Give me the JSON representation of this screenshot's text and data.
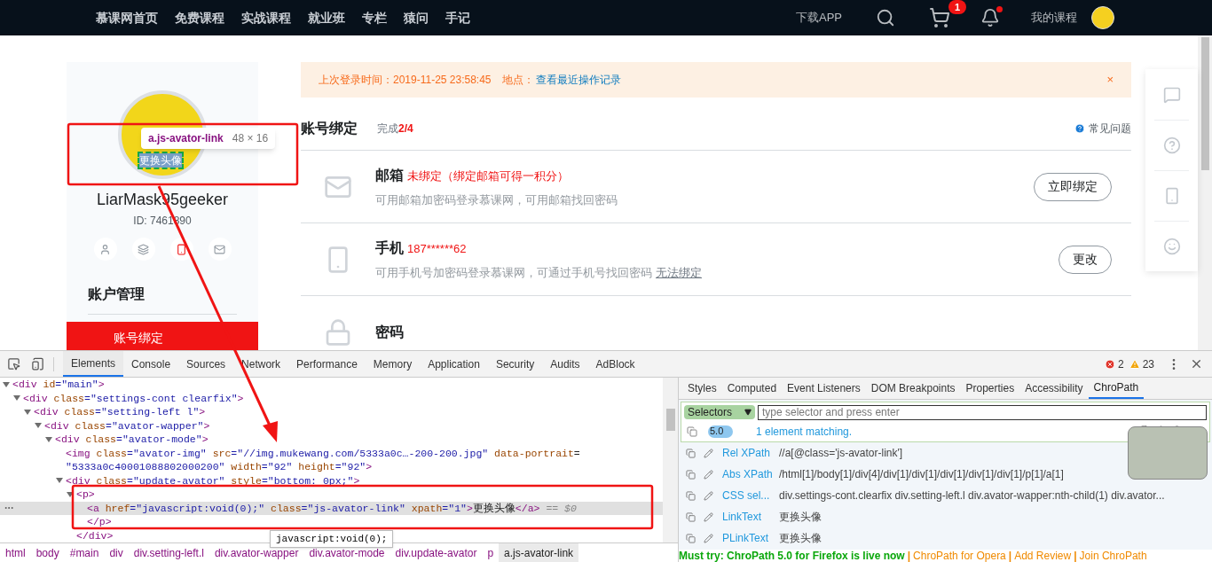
{
  "nav": {
    "items": [
      "慕课网首页",
      "免费课程",
      "实战课程",
      "就业班",
      "专栏",
      "猿问",
      "手记"
    ],
    "download": "下载APP",
    "cart_badge": "1",
    "my_courses": "我的课程"
  },
  "sidebar": {
    "tooltip": {
      "selector": "a.js-avator-link",
      "size": "48 × 16"
    },
    "avatar_link": "更换头像",
    "username": "LiarMask95geeker",
    "user_id": "ID: 7461890",
    "profile_icons": [
      {
        "kind": "user",
        "selected": false
      },
      {
        "kind": "layers",
        "selected": false
      },
      {
        "kind": "phone",
        "selected": true
      },
      {
        "kind": "mail",
        "selected": false
      }
    ],
    "section_title": "账户管理",
    "menu": [
      {
        "label": "账号绑定",
        "selected": true
      }
    ]
  },
  "notice": {
    "text": "上次登录时间：2019-11-25 23:58:45",
    "location_label": "地点：",
    "link": "查看最近操作记录",
    "close": "×"
  },
  "binding": {
    "title": "账号绑定",
    "progress_label": "完成",
    "progress": "2/4",
    "help": "常见问题",
    "rows": [
      {
        "kind": "mail",
        "name": "邮箱",
        "status": "未绑定（绑定邮箱可得一积分）",
        "description": "可用邮箱加密码登录慕课网，可用邮箱找回密码",
        "button": "立即绑定"
      },
      {
        "kind": "phone",
        "name": "手机",
        "status": "187******62",
        "description": "可用手机号加密码登录慕课网，可通过手机号找回密码",
        "link": "无法绑定",
        "button": "更改"
      },
      {
        "kind": "lock",
        "name": "密码"
      }
    ]
  },
  "float_toolbar": [
    {
      "kind": "feedback"
    },
    {
      "kind": "help"
    },
    {
      "kind": "phone"
    },
    {
      "kind": "chat"
    }
  ],
  "devtools": {
    "tabs": [
      {
        "label": "Elements",
        "selected": true
      },
      {
        "label": "Console",
        "selected": false
      },
      {
        "label": "Sources",
        "selected": false
      },
      {
        "label": "Network",
        "selected": false
      },
      {
        "label": "Performance",
        "selected": false
      },
      {
        "label": "Memory",
        "selected": false
      },
      {
        "label": "Application",
        "selected": false
      },
      {
        "label": "Security",
        "selected": false
      },
      {
        "label": "Audits",
        "selected": false
      },
      {
        "label": "AdBlock",
        "selected": false
      }
    ],
    "errors": "2",
    "warnings": "23",
    "tree": [
      {
        "lines": [
          "<div id=\"main\">"
        ],
        "expanded": true,
        "selected": false,
        "children": [
          {
            "lines": [
              "<div class=\"settings-cont clearfix\">"
            ],
            "expanded": true,
            "selected": false,
            "children": [
              {
                "lines": [
                  "<div class=\"setting-left l\">"
                ],
                "expanded": true,
                "selected": false,
                "children": [
                  {
                    "lines": [
                      "<div class=\"avator-wapper\">"
                    ],
                    "expanded": true,
                    "selected": false,
                    "children": [
                      {
                        "lines": [
                          "<div class=\"avator-mode\">"
                        ],
                        "expanded": true,
                        "selected": false,
                        "children": [
                          {
                            "lines": [
                              "<img class=\"avator-img\" src=\"//img.mukewang.com/5333a0c…-200-200.jpg\" data-portrait=",
                              "\"5333a0c40001088802000200\" width=\"92\" height=\"92\">"
                            ],
                            "selected": false
                          },
                          {
                            "lines": [
                              "<div class=\"update-avator\" style=\"bottom: 0px;\">"
                            ],
                            "expanded": true,
                            "selected": false,
                            "children": [
                              {
                                "lines": [
                                  "<p>"
                                ],
                                "expanded": true,
                                "selected": false,
                                "children": [
                                  {
                                    "lines": [
                                      "<a href=\"javascript:void(0);\" class=\"js-avator-link\" xpath=\"1\">更换头像</a>"
                                    ],
                                    "suffix": "== $0",
                                    "selected": true
                                  },
                                  {
                                    "lines": [
                                      "</p>"
                                    ],
                                    "selected": false
                                  }
                                ]
                              },
                              {
                                "lines": [
                                  "</div>"
                                ],
                                "selected": false
                              }
                            ]
                          }
                        ]
                      }
                    ]
                  }
                ]
              }
            ]
          }
        ]
      }
    ],
    "link_tooltip": "javascript:void(0);",
    "breadcrumbs": [
      {
        "label": "html",
        "selected": false
      },
      {
        "label": "body",
        "selected": false
      },
      {
        "label": "#main",
        "selected": false
      },
      {
        "label": "div",
        "selected": false
      },
      {
        "label": "div.setting-left.l",
        "selected": false
      },
      {
        "label": "div.avator-wapper",
        "selected": false
      },
      {
        "label": "div.avator-mode",
        "selected": false
      },
      {
        "label": "div.update-avator",
        "selected": false
      },
      {
        "label": "p",
        "selected": false
      },
      {
        "label": "a.js-avator-link",
        "selected": true
      }
    ],
    "side_tabs": [
      {
        "label": "Styles",
        "selected": false
      },
      {
        "label": "Computed",
        "selected": false
      },
      {
        "label": "Event Listeners",
        "selected": false
      },
      {
        "label": "DOM Breakpoints",
        "selected": false
      },
      {
        "label": "Properties",
        "selected": false
      },
      {
        "label": "Accessibility",
        "selected": false
      },
      {
        "label": "ChroPath",
        "selected": true
      }
    ],
    "chropath": {
      "mode": "Selectors",
      "placeholder": "type selector and press enter",
      "version": "5.0",
      "version_on": true,
      "matching": "1 element matching.",
      "rows": [
        {
          "label": "Rel XPath",
          "value": "//a[@class='js-avator-link']"
        },
        {
          "label": "Abs XPath",
          "value": "/html[1]/body[1]/div[4]/div[1]/div[1]/div[1]/div[1]/div[1]/p[1]/a[1]"
        },
        {
          "label": "CSS sel...",
          "value": "div.settings-cont.clearfix div.setting-left.l div.avator-wapper:nth-child(1) div.avator..."
        },
        {
          "label": "LinkText",
          "value": "更换头像"
        },
        {
          "label": "PLinkText",
          "value": "更换头像"
        }
      ],
      "promo": "Must try: ChroPath 5.0 for Firefox is live now",
      "separator": "|",
      "promo_links": [
        "ChroPath for Opera",
        "Add Review",
        "Join ChroPath"
      ]
    }
  }
}
